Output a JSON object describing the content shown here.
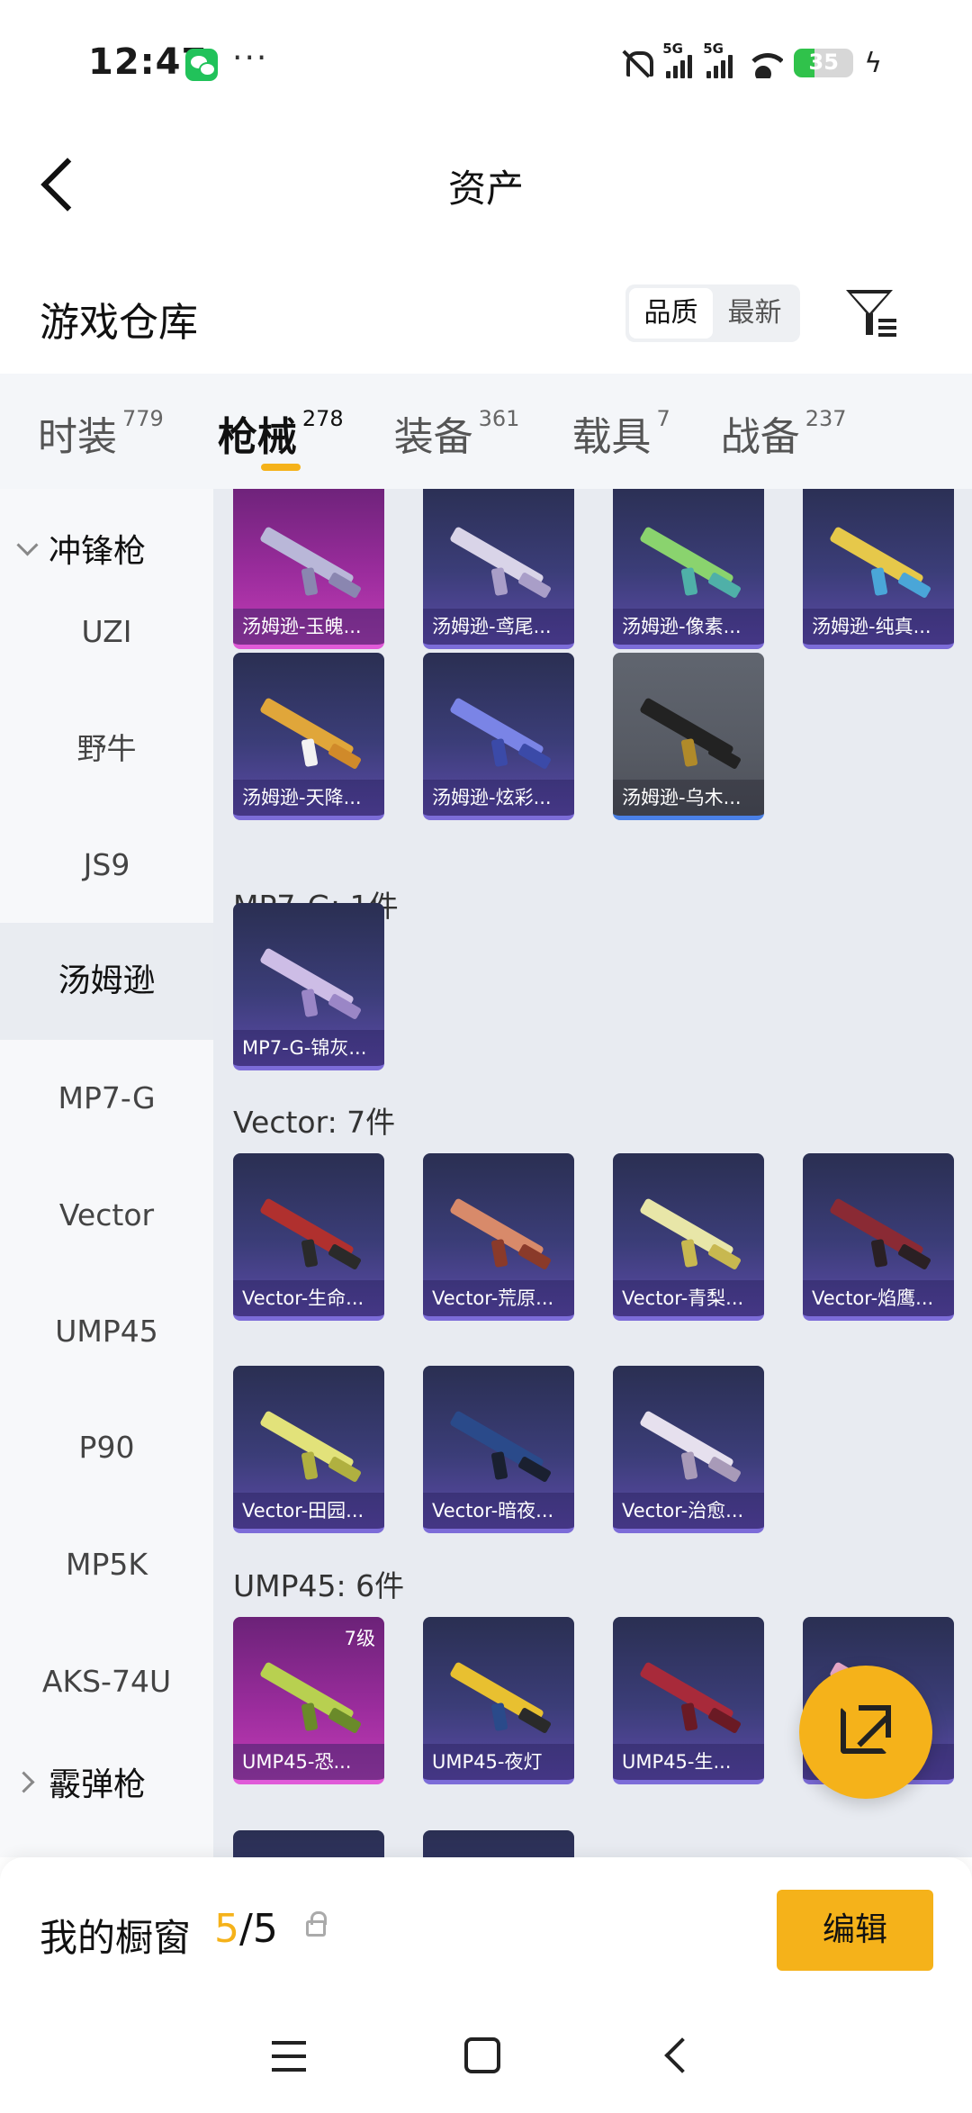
{
  "status_bar": {
    "time": "12:47",
    "dots": "···",
    "battery": "35",
    "net1": "5G",
    "net2": "5G"
  },
  "header": {
    "title": "资产"
  },
  "warehouse": {
    "title": "游戏仓库",
    "sort_options": [
      {
        "label": "品质",
        "active": true
      },
      {
        "label": "最新",
        "active": false
      }
    ]
  },
  "tabs": [
    {
      "label": "时装",
      "count": "779"
    },
    {
      "label": "枪械",
      "count": "278"
    },
    {
      "label": "装备",
      "count": "361"
    },
    {
      "label": "载具",
      "count": "7"
    },
    {
      "label": "战备",
      "count": "237"
    }
  ],
  "sidebar": {
    "group_smg": "冲锋枪",
    "items": [
      "UZI",
      "野牛",
      "JS9",
      "汤姆逊",
      "MP7-G",
      "Vector",
      "UMP45",
      "P90",
      "MP5K",
      "AKS-74U"
    ],
    "group_shotgun": "霰弹枪"
  },
  "content": {
    "thompson_row1": [
      "汤姆逊-玉魄...",
      "汤姆逊-鸢尾...",
      "汤姆逊-像素...",
      "汤姆逊-纯真..."
    ],
    "thompson_row2": [
      "汤姆逊-天降...",
      "汤姆逊-炫彩...",
      "汤姆逊-乌木..."
    ],
    "mp7_title": "MP7-G: 1件",
    "mp7_items": [
      "MP7-G-锦灰..."
    ],
    "vector_title": "Vector: 7件",
    "vector_row1": [
      "Vector-生命...",
      "Vector-荒原...",
      "Vector-青梨...",
      "Vector-焰鹰..."
    ],
    "vector_row2": [
      "Vector-田园...",
      "Vector-暗夜...",
      "Vector-治愈..."
    ],
    "ump_title": "UMP45: 6件",
    "ump_row1": [
      "UMP45-恐...",
      "UMP45-夜灯",
      "UMP45-生...",
      "..."
    ],
    "ump_level": "7级"
  },
  "showcase": {
    "title": "我的橱窗",
    "current": "5",
    "sep_total": "/5",
    "edit_label": "编辑"
  }
}
